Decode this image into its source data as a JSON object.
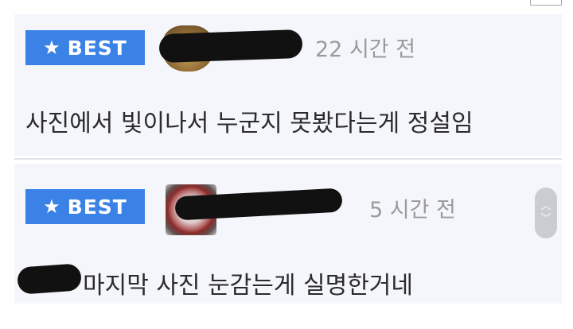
{
  "comments": [
    {
      "badge": "BEST",
      "time": "22 시간 전",
      "text": "사진에서 빛이나서 누군지 못봤다는게 정설임"
    },
    {
      "badge": "BEST",
      "time": "5 시간 전",
      "text": "마지막 사진 눈감는게 실명한거네"
    }
  ],
  "icons": {
    "badge_star": "star-icon",
    "scroll_up": "chevron-up-icon",
    "scroll_down": "chevron-down-icon"
  },
  "colors": {
    "badge_bg": "#3a82e6",
    "card_bg": "#f4f6fb",
    "time_text": "#9a9a9a"
  }
}
